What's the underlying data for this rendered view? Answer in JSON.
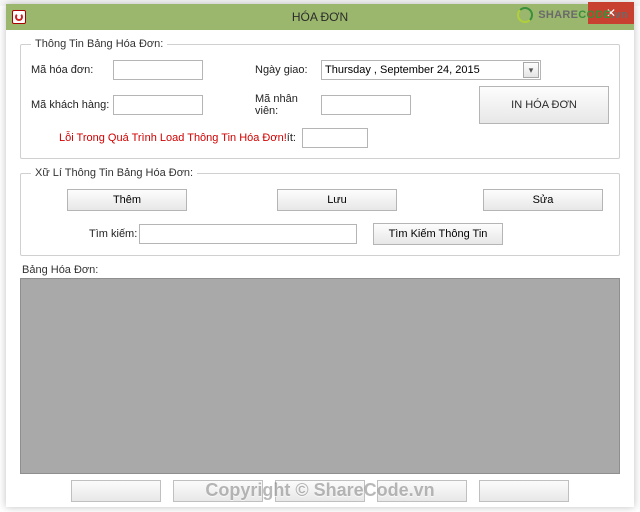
{
  "window": {
    "title": "HÓA ĐƠN"
  },
  "brand": {
    "text_prefix": "SHARE",
    "text_bold": "CODE",
    "text_suffix": ".vn"
  },
  "info": {
    "legend": "Thông Tin Bảng Hóa Đơn:",
    "ma_hoa_don_label": "Mã hóa đơn:",
    "ma_hoa_don_value": "",
    "ma_kh_label": "Mã khách hàng:",
    "ma_kh_value": "",
    "ngay_giao_label": "Ngày giao:",
    "ngay_giao_value": "Thursday , September 24, 2015",
    "ma_nv_label": "Mã nhân viên:",
    "ma_nv_value": "",
    "error_text": "Lỗi Trong Quá Trình Load Thông Tin Hóa Đơn!",
    "error_suffix": " ít:",
    "extra_value": "",
    "print_btn": "IN HÓA ĐƠN"
  },
  "process": {
    "legend": "Xữ Lí Thông Tin Bảng Hóa Đơn:",
    "add_btn": "Thêm",
    "save_btn": "Lưu",
    "edit_btn": "Sửa",
    "search_label": "Tìm kiếm:",
    "search_value": "",
    "search_btn": "Tìm Kiếm Thông Tin"
  },
  "grid": {
    "label": "Bảng Hóa Đơn:"
  },
  "watermark": "Copyright © ShareCode.vn"
}
